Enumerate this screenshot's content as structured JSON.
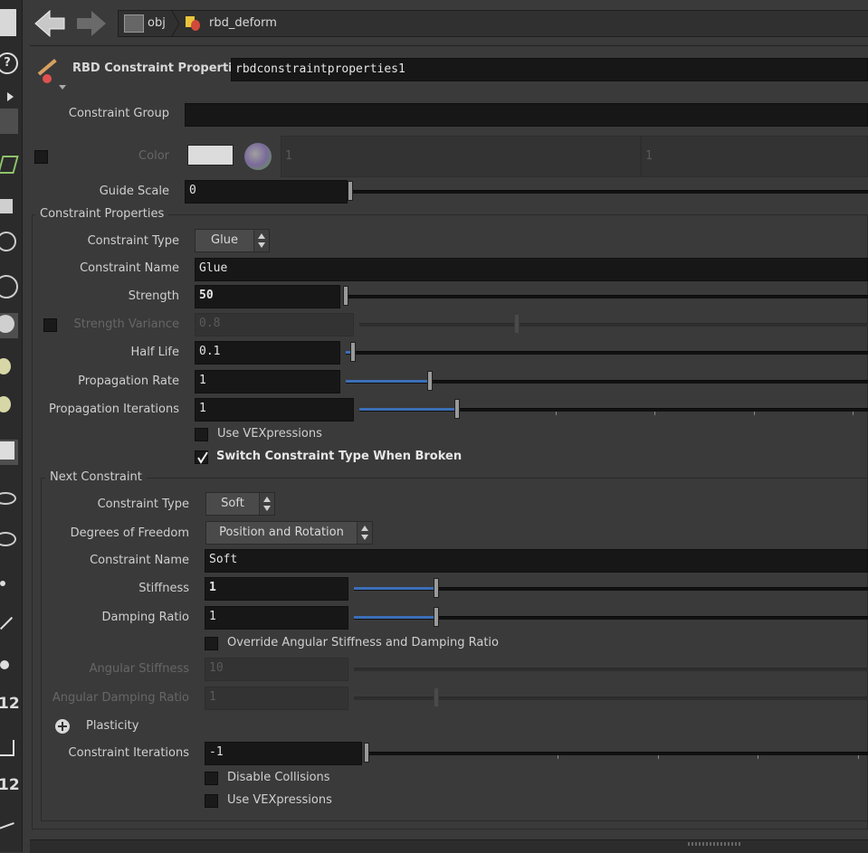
{
  "nav": {
    "path": [
      {
        "label": "obj",
        "icon": "obj-context-icon"
      },
      {
        "label": "rbd_deform",
        "icon": "geometry-node-icon"
      }
    ]
  },
  "node": {
    "type_label": "RBD Constraint Properties",
    "name": "rbdconstraintproperties1"
  },
  "params": {
    "constraint_group": {
      "label": "Constraint Group",
      "value": ""
    },
    "color": {
      "label": "Color",
      "swatch": "#dcdcdc",
      "r": "1",
      "g": "1"
    },
    "guide_scale": {
      "label": "Guide Scale",
      "value": "0",
      "slider": 0.0
    }
  },
  "constraint_properties": {
    "title": "Constraint Properties",
    "type": {
      "label": "Constraint Type",
      "value": "Glue"
    },
    "name": {
      "label": "Constraint Name",
      "value": "Glue"
    },
    "strength": {
      "label": "Strength",
      "value": "50"
    },
    "strength_variance": {
      "label": "Strength Variance",
      "value": "0.8"
    },
    "half_life": {
      "label": "Half Life",
      "value": "0.1"
    },
    "propagation_rate": {
      "label": "Propagation Rate",
      "value": "1"
    },
    "propagation_iterations": {
      "label": "Propagation Iterations",
      "value": "1"
    },
    "use_vexpressions": {
      "label": "Use VEXpressions",
      "checked": false
    },
    "switch_type": {
      "label": "Switch Constraint Type When Broken",
      "checked": true
    }
  },
  "next_constraint": {
    "title": "Next Constraint",
    "type": {
      "label": "Constraint Type",
      "value": "Soft"
    },
    "dof": {
      "label": "Degrees of Freedom",
      "value": "Position and Rotation"
    },
    "name": {
      "label": "Constraint Name",
      "value": "Soft"
    },
    "stiffness": {
      "label": "Stiffness",
      "value": "1"
    },
    "damping_ratio": {
      "label": "Damping Ratio",
      "value": "1"
    },
    "override_angular": {
      "label": "Override Angular Stiffness and Damping Ratio",
      "checked": false
    },
    "angular_stiffness": {
      "label": "Angular Stiffness",
      "value": "10"
    },
    "angular_damping": {
      "label": "Angular Damping Ratio",
      "value": "1"
    },
    "plasticity": {
      "label": "Plasticity"
    },
    "constraint_iterations": {
      "label": "Constraint Iterations",
      "value": "-1"
    },
    "disable_collisions": {
      "label": "Disable Collisions",
      "checked": false
    },
    "use_vexpressions": {
      "label": "Use VEXpressions",
      "checked": false
    }
  },
  "left_toolbar": {
    "badge_1": "12",
    "badge_2": "12"
  }
}
